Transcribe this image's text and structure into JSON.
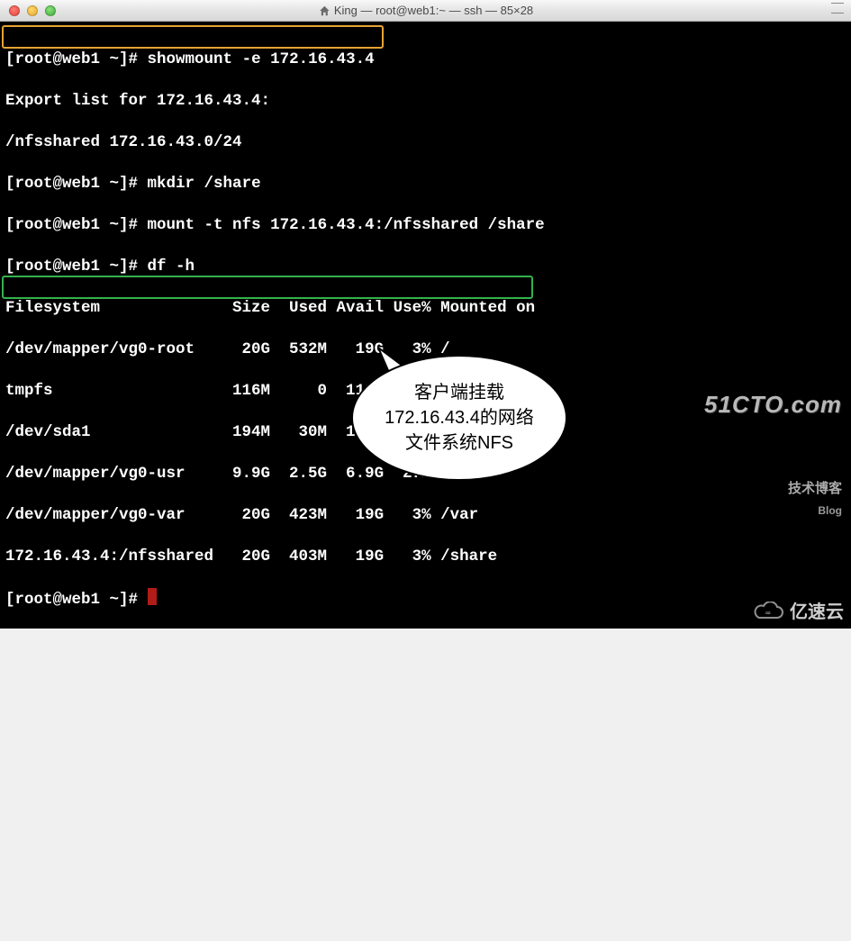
{
  "titlebar": {
    "title": "King — root@web1:~ — ssh — 85×28"
  },
  "prompt": "[root@web1 ~]#",
  "commands": {
    "showmount": "showmount -e 172.16.43.4",
    "exportlist": "Export list for 172.16.43.4:",
    "exportentry": "/nfsshared 172.16.43.0/24",
    "mkdir": "mkdir /share",
    "mount": "mount -t nfs 172.16.43.4:/nfsshared /share",
    "df": "df -h"
  },
  "df_header": "Filesystem              Size  Used Avail Use% Mounted on",
  "df_rows": [
    "/dev/mapper/vg0-root     20G  532M   19G   3% /",
    "tmpfs                   116M     0  116M   0% /dev/shm",
    "/dev/sda1               194M   30M  155M  16% /boot",
    "/dev/mapper/vg0-usr     9.9G  2.5G  6.9G  27% /usr",
    "/dev/mapper/vg0-var      20G  423M   19G   3% /var",
    "172.16.43.4:/nfsshared   20G  403M   19G   3% /share"
  ],
  "callout": {
    "text": "客户端挂载172.16.43.4的网络文件系统NFS"
  },
  "watermark1": {
    "line1": "51CTO.com",
    "line2": "技术博客",
    "line3": "Blog"
  },
  "watermark2": {
    "text": "亿速云"
  }
}
